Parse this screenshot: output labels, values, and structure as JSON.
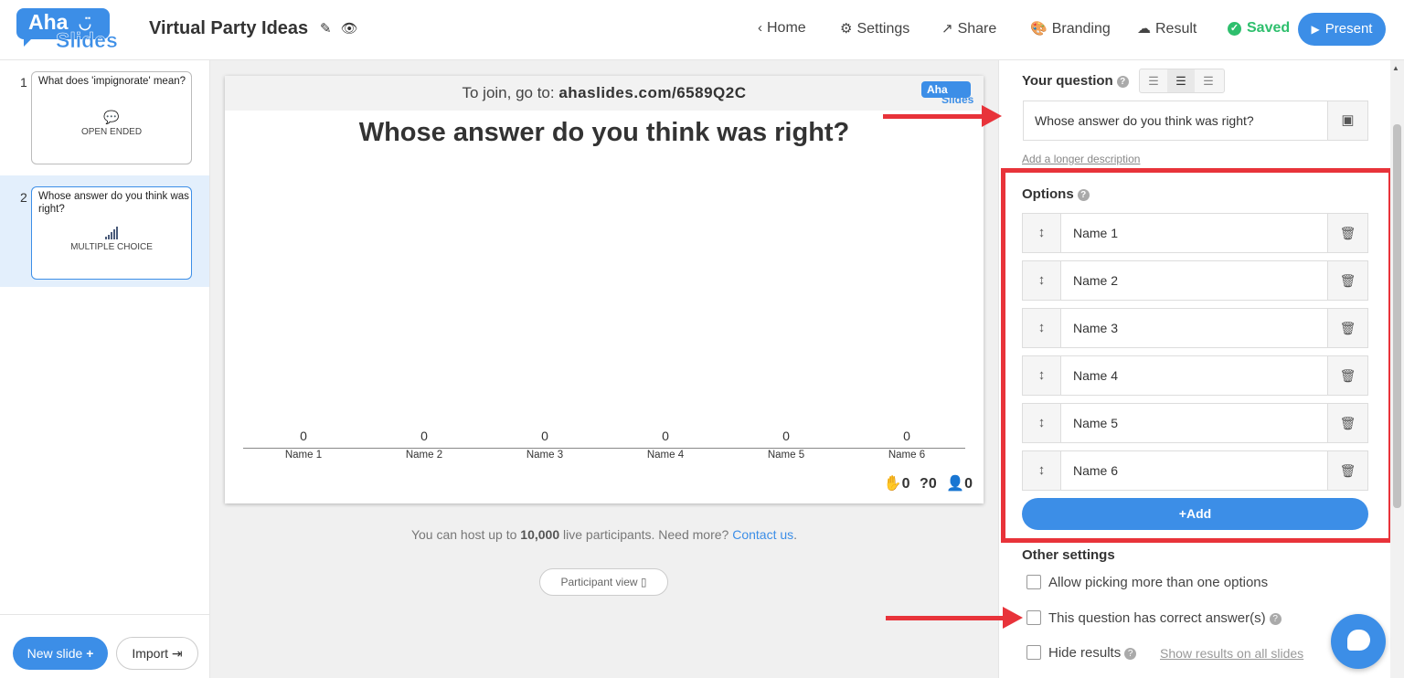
{
  "header": {
    "logo_top": "Aha",
    "logo_bottom": "Slides",
    "doc_title": "Virtual Party Ideas",
    "nav": {
      "home": "Home",
      "settings": "Settings",
      "share": "Share",
      "branding": "Branding",
      "result": "Result",
      "saved": "Saved",
      "present": "Present"
    }
  },
  "slides": [
    {
      "num": "1",
      "question": "What does 'impignorate' mean?",
      "type": "OPEN ENDED",
      "type_icon": "speech-bubble-icon"
    },
    {
      "num": "2",
      "question": "Whose answer do you think was right?",
      "type": "MULTIPLE CHOICE",
      "type_icon": "bar-chart-icon"
    }
  ],
  "sidebar_actions": {
    "new_slide": "New slide",
    "import": "Import"
  },
  "canvas": {
    "join_prefix": "To join, go to:",
    "join_url": "ahaslides.com/6589Q2C",
    "mini_logo_top": "Aha",
    "mini_logo_bottom": "Slides",
    "title": "Whose answer do you think was right?",
    "stats": {
      "hands": "0",
      "questions": "0",
      "participants": "0"
    }
  },
  "chart_data": {
    "type": "bar",
    "categories": [
      "Name 1",
      "Name 2",
      "Name 3",
      "Name 4",
      "Name 5",
      "Name 6"
    ],
    "values": [
      0,
      0,
      0,
      0,
      0,
      0
    ]
  },
  "host_note": {
    "prefix": "You can host up to",
    "count": "10,000",
    "suffix": "live participants. Need more?",
    "link": "Contact us",
    "end": "."
  },
  "participant_view": "Participant view",
  "editor": {
    "your_question_label": "Your question",
    "question_value": "Whose answer do you think was right?",
    "add_description": "Add a longer description",
    "options_label": "Options",
    "options": [
      "Name 1",
      "Name 2",
      "Name 3",
      "Name 4",
      "Name 5",
      "Name 6"
    ],
    "add_label": "Add",
    "other_settings_label": "Other settings",
    "checkbox_multi": "Allow picking more than one options",
    "checkbox_correct": "This question has correct answer(s)",
    "checkbox_hide": "Hide results",
    "show_results_all": "Show results on all slides"
  },
  "colors": {
    "accent": "#3c8ee7",
    "saved_green": "#2ebf6d",
    "annotation_red": "#e8333a"
  }
}
